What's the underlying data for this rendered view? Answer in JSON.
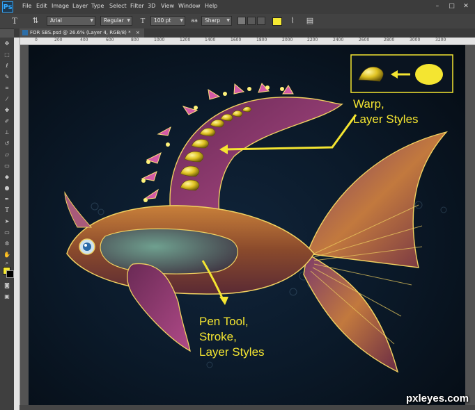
{
  "app": {
    "logo": "Ps"
  },
  "menu": [
    "File",
    "Edit",
    "Image",
    "Layer",
    "Type",
    "Select",
    "Filter",
    "3D",
    "View",
    "Window",
    "Help"
  ],
  "window_controls": [
    "minimize-icon",
    "maximize-icon",
    "close-icon"
  ],
  "options_bar": {
    "font_family": "Arial",
    "font_style": "Regular",
    "font_size": "100 pt",
    "antialias": "Sharp",
    "text_color": "#f5e932"
  },
  "document_tab": {
    "label": "FOR SBS.psd @ 26.6% (Layer 4, RGB/8) *"
  },
  "ruler": {
    "top_labels": [
      "0",
      "200",
      "400",
      "600",
      "800",
      "1000",
      "1200",
      "1400",
      "1600",
      "1800",
      "2000",
      "2200",
      "2400",
      "2600",
      "2800",
      "3000",
      "3200"
    ]
  },
  "colors": {
    "foreground": "#f5e932",
    "background": "#000000",
    "annotation": "#f4e531"
  },
  "annotations": {
    "top_right_line1": "Warp,",
    "top_right_line2": "Layer Styles",
    "bottom_line1": "Pen Tool,",
    "bottom_line2": "Stroke,",
    "bottom_line3": "Layer Styles"
  },
  "watermark": "pxleyes.com"
}
